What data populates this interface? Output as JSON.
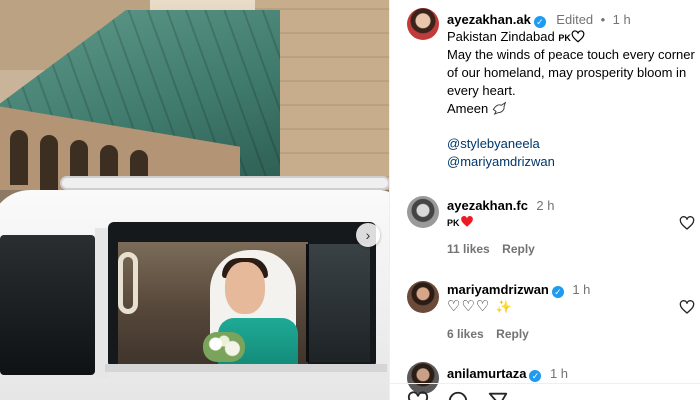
{
  "post": {
    "author": "ayezakhan.ak",
    "edited_label": "Edited",
    "separator": "•",
    "time": "1 h",
    "caption_line1_text": "Pakistan Zindabad",
    "caption_line1_flag": "PK",
    "caption_body": "May the winds of peace touch every corner of our homeland, may prosperity bloom in every heart.",
    "caption_line2": "Ameen",
    "mention1": "@stylebyaneela",
    "mention2": "@mariyamdrizwan"
  },
  "comments": [
    {
      "author": "ayezakhan.fc",
      "time": "2 h",
      "text": "PK",
      "likes": "11 likes",
      "reply": "Reply"
    },
    {
      "author": "mariyamdrizwan",
      "time": "1 h",
      "text": "♡♡♡",
      "likes": "6 likes",
      "reply": "Reply"
    },
    {
      "author": "anilamurtaza",
      "time": "1 h"
    }
  ],
  "colors": {
    "verified": "#1d9bf0",
    "link": "#00376b",
    "red_heart": "#ed1c24"
  }
}
